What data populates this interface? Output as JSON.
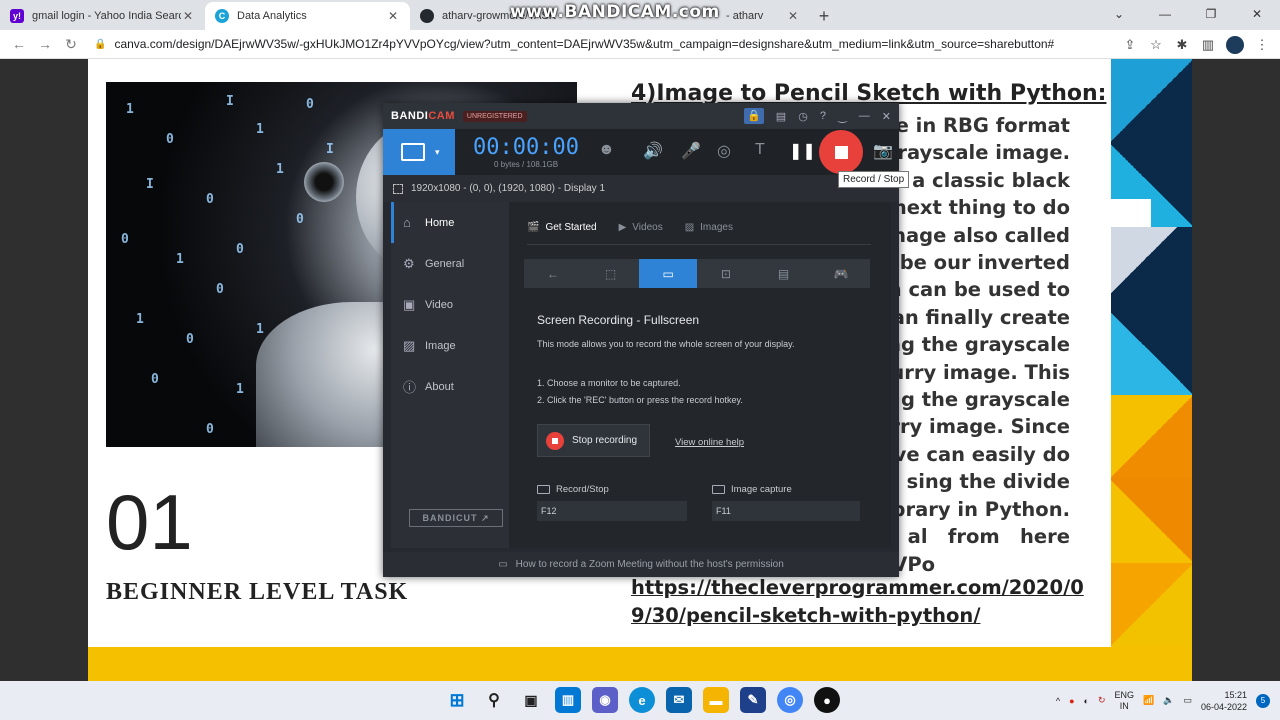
{
  "browser": {
    "tabs": [
      {
        "title": "gmail login - Yahoo India Search",
        "icon": "yahoo-icon",
        "color": "#6001d2",
        "glyph": "y!"
      },
      {
        "title": "Data Analytics",
        "icon": "canva-icon",
        "color": "#1ba3d8",
        "glyph": "C"
      },
      {
        "title": "atharv-growmore/TASK",
        "icon": "github-icon",
        "color": "#24292f",
        "glyph": "●"
      },
      {
        "title": "- atharv",
        "icon": "github-icon",
        "color": "#24292f",
        "glyph": ""
      }
    ],
    "watermark": "www.BANDICAM.com",
    "url": "canva.com/design/DAEjrwWV35w/-gxHUkJMO1Zr4pYVVpOYcg/view?utm_content=DAEjrwWV35w&utm_campaign=designshare&utm_medium=link&utm_source=sharebutton#11"
  },
  "page": {
    "number": "01",
    "task": "BEGINNER LEVEL TASK",
    "title": "4)Image to Pencil Sketch with Python:",
    "lines": [
      "e in RBG format",
      "grayscale image.",
      "a classic black",
      "next thing to do",
      "nage also called",
      "be our inverted",
      "n can be used to",
      "can finally create",
      "ng the grayscale",
      "lurry image. This",
      "g the grayscale",
      "rry image. Since",
      "ve can easily do",
      "sing the divide",
      "brary in Python.",
      "al   from   here",
      "PVPo"
    ],
    "link_line1": "https://thecleverprogrammer.com/2020/0",
    "link_line2": "9/30/pencil-sketch-with-python/"
  },
  "bandicam": {
    "logo_a": "BANDI",
    "logo_b": "CAM",
    "registered": "UNREGISTERED",
    "time": "00:00:00",
    "size": "0 bytes / 108.1GB",
    "tooltip": "Record / Stop",
    "resolution": "1920x1080 - (0, 0), (1920, 1080) - Display 1",
    "sidebar": [
      {
        "label": "Home",
        "icon": "home-icon",
        "glyph": "⌂"
      },
      {
        "label": "General",
        "icon": "gear-icon",
        "glyph": "⚙"
      },
      {
        "label": "Video",
        "icon": "video-icon",
        "glyph": "▣"
      },
      {
        "label": "Image",
        "icon": "image-icon",
        "glyph": "▨"
      },
      {
        "label": "About",
        "icon": "info-icon",
        "glyph": "ⓘ"
      }
    ],
    "bandicut": "BANDICUT ↗",
    "tabs": [
      {
        "label": "Get Started",
        "glyph": "🎬"
      },
      {
        "label": "Videos",
        "glyph": "▶"
      },
      {
        "label": "Images",
        "glyph": "▨"
      }
    ],
    "mode_title": "Screen Recording - Fullscreen",
    "mode_desc": "This mode allows you to record the whole screen of your display.",
    "step1": "1. Choose a monitor to be captured.",
    "step2": "2. Click the 'REC' button or press the record hotkey.",
    "stop_label": "Stop recording",
    "help_label": "View online help",
    "record_stop_label": "Record/Stop",
    "record_stop_key": "F12",
    "image_capture_label": "Image capture",
    "image_capture_key": "F11",
    "footer": "How to record a Zoom Meeting without the host's permission"
  },
  "taskbar": {
    "lang1": "ENG",
    "lang2": "IN",
    "time": "15:21",
    "date": "06-04-2022",
    "notif": "5"
  }
}
